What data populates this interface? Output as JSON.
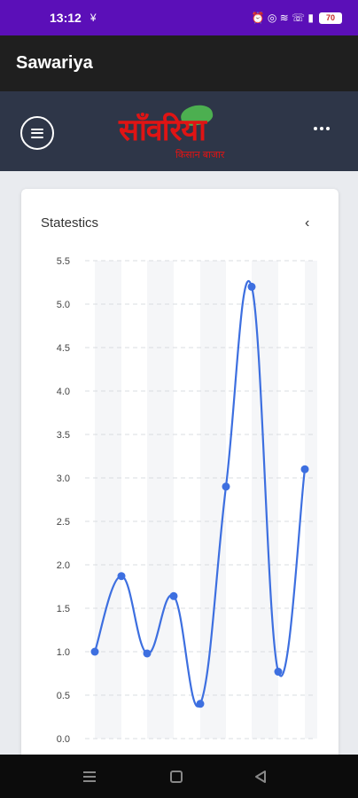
{
  "status_bar": {
    "time": "13:12",
    "carrier_symbol": "¥",
    "status_symbols": "⏰ ◎ ≋ ☏ ▮",
    "battery": "70"
  },
  "app_bar": {
    "title": "Sawariya"
  },
  "header": {
    "logo_text": "साँवरिया",
    "logo_subtext": "किसान बाजार"
  },
  "card": {
    "title": "Statestics",
    "collapse_icon": "chevron-left-icon"
  },
  "colors": {
    "status_bar": "#5b0fb8",
    "app_bar": "#1f1f1f",
    "header": "#2e3648",
    "line": "#3d6fe0",
    "logo_red": "#e01414",
    "logo_leaf": "#4caf50"
  },
  "chart_data": {
    "type": "line",
    "title": "",
    "xlabel": "",
    "ylabel": "",
    "y_ticks": [
      "0.0",
      "0.5",
      "1.0",
      "1.5",
      "2.0",
      "2.5",
      "3.0",
      "3.5",
      "4.0",
      "4.5",
      "5.0",
      "5.5"
    ],
    "ylim": [
      0,
      5.5
    ],
    "smooth": true,
    "grid": "horizontal dashed, alternating vertical bands",
    "series": [
      {
        "values": [
          1.0,
          1.87,
          0.98,
          1.64,
          0.4,
          2.9,
          5.2,
          0.77,
          3.1
        ]
      }
    ]
  }
}
